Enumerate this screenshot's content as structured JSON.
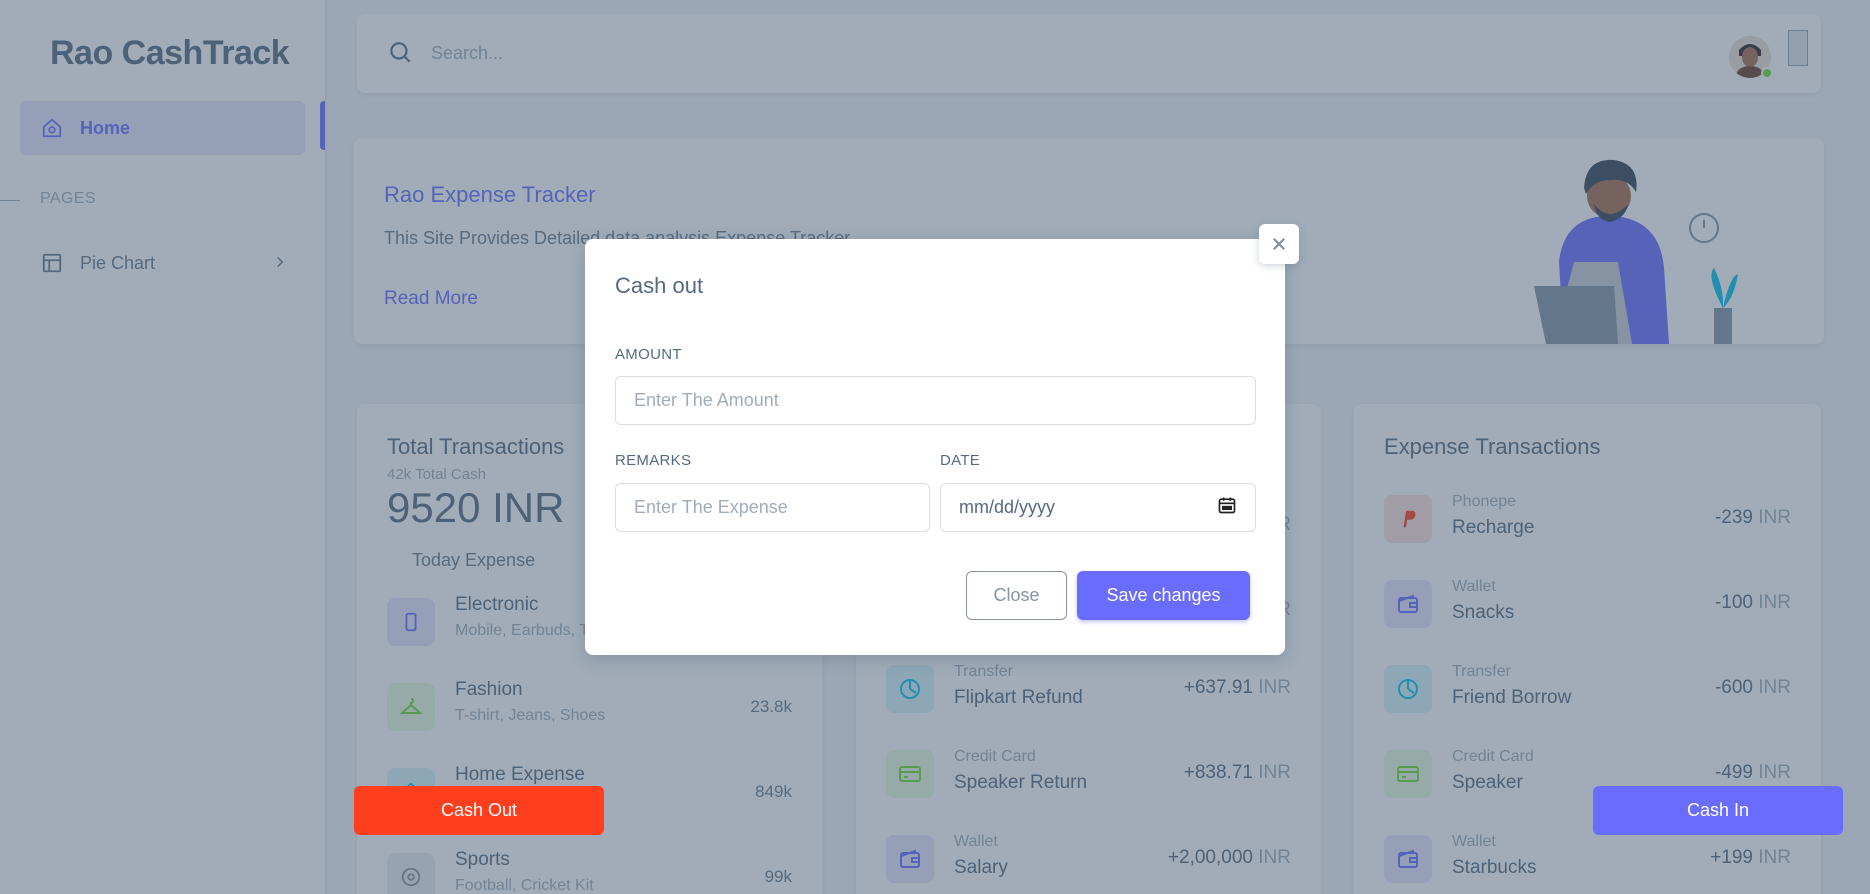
{
  "brand": "Rao CashTrack",
  "sidebar": {
    "items": [
      {
        "label": "Home",
        "icon": "home-icon"
      },
      {
        "label": "Pie Chart",
        "icon": "layout-icon"
      }
    ],
    "section_header": "PAGES"
  },
  "navbar": {
    "search_placeholder": "Search..."
  },
  "welcome": {
    "title": "Rao Expense Tracker",
    "text": "This Site Provides Detailed data analysis Expense Tracker",
    "link": "Read More"
  },
  "total": {
    "title": "Total Transactions",
    "subtitle": "42k Total Cash",
    "amount": "9520 INR",
    "today_label": "Today Expense",
    "rows": [
      {
        "name": "Electronic",
        "sub": "Mobile, Earbuds, TV",
        "value": "",
        "icon": "mobile-icon"
      },
      {
        "name": "Fashion",
        "sub": "T-shirt, Jeans, Shoes",
        "value": "23.8k",
        "icon": "hanger-icon"
      },
      {
        "name": "Home Expense",
        "sub": "",
        "value": "849k",
        "icon": "home-icon"
      },
      {
        "name": "Sports",
        "sub": "Football, Cricket Kit",
        "value": "99k",
        "icon": "football-icon"
      }
    ]
  },
  "income": {
    "rows": [
      {
        "sub": "",
        "name": "",
        "amount": "",
        "unit": "INR"
      },
      {
        "sub": "",
        "name": "",
        "amount": "",
        "unit": "INR"
      },
      {
        "sub": "Transfer",
        "name": "Flipkart Refund",
        "amount": "+637.91",
        "unit": "INR",
        "icon": "pie-icon"
      },
      {
        "sub": "Credit Card",
        "name": "Speaker Return",
        "amount": "+838.71",
        "unit": "INR",
        "icon": "credit-card-icon"
      },
      {
        "sub": "Wallet",
        "name": "Salary",
        "amount": "+2,00,000",
        "unit": "INR",
        "icon": "wallet-icon"
      }
    ]
  },
  "expense": {
    "title": "Expense Transactions",
    "rows": [
      {
        "sub": "Phonepe",
        "name": "Recharge",
        "amount": "-239",
        "unit": "INR",
        "icon": "paypal-icon"
      },
      {
        "sub": "Wallet",
        "name": "Snacks",
        "amount": "-100",
        "unit": "INR",
        "icon": "wallet-icon"
      },
      {
        "sub": "Transfer",
        "name": "Friend Borrow",
        "amount": "-600",
        "unit": "INR",
        "icon": "pie-icon"
      },
      {
        "sub": "Credit Card",
        "name": "Speaker",
        "amount": "-499",
        "unit": "INR",
        "icon": "credit-card-icon"
      },
      {
        "sub": "Wallet",
        "name": "Starbucks",
        "amount": "+199",
        "unit": "INR",
        "icon": "wallet-icon"
      }
    ]
  },
  "buttons": {
    "cash_out": "Cash Out",
    "cash_in": "Cash In"
  },
  "modal": {
    "title": "Cash out",
    "amount_label": "AMOUNT",
    "amount_placeholder": "Enter The Amount",
    "remarks_label": "REMARKS",
    "remarks_placeholder": "Enter The Expense",
    "date_label": "DATE",
    "date_placeholder": "mm/dd/yyyy",
    "close_label": "Close",
    "save_label": "Save changes"
  },
  "colors": {
    "primary": "#696cff",
    "danger": "#ff3e1d",
    "success": "#71dd37",
    "info": "#03c3ec"
  }
}
